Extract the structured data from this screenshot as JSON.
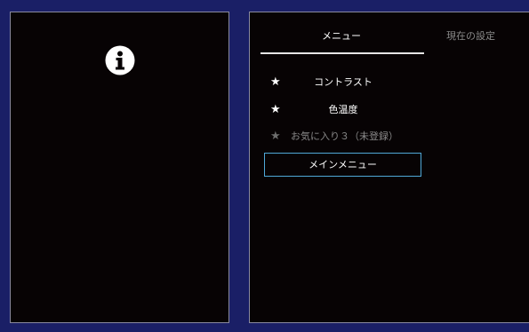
{
  "left_panel": {
    "icon": "info-icon"
  },
  "tabs": [
    {
      "label": "メニュー",
      "selected": true
    },
    {
      "label": "現在の設定",
      "selected": false
    }
  ],
  "menu_items": [
    {
      "icon": "star-icon",
      "label": "コントラスト",
      "enabled": true
    },
    {
      "icon": "star-icon",
      "label": "色温度",
      "enabled": true
    },
    {
      "icon": "star-icon",
      "label": "お気に入り３（未登録）",
      "enabled": false
    }
  ],
  "main_menu_button": {
    "label": "メインメニュー"
  },
  "colors": {
    "background": "#1a1f66",
    "panel": "#070304",
    "focus_border": "#4fa8d8",
    "disabled_text": "#8a8a8a"
  }
}
